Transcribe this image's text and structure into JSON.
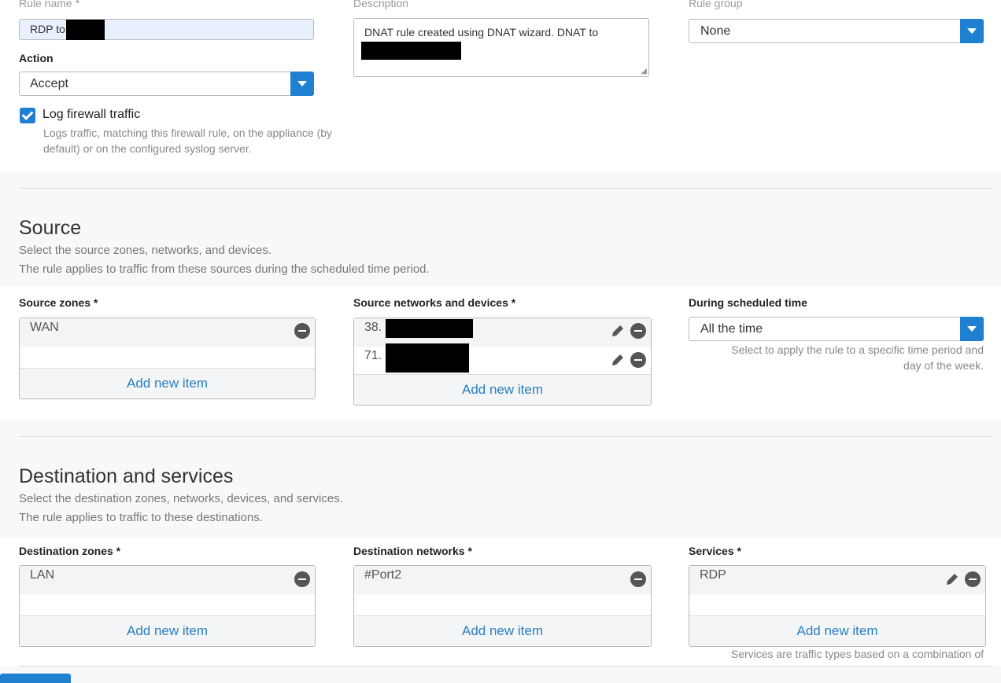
{
  "rule": {
    "name_label": "Rule name *",
    "name_value": "RDP to",
    "description_label": "Description",
    "description_value": "DNAT rule created using DNAT wizard. DNAT to",
    "group_label": "Rule group",
    "group_value": "None",
    "action_label": "Action",
    "action_value": "Accept",
    "log_label": "Log firewall traffic",
    "log_checked": true,
    "log_help_line1": "Logs traffic, matching this firewall rule, on the appliance (by",
    "log_help_line2": "default) or on the configured syslog server."
  },
  "source": {
    "title": "Source",
    "subtitle_line1": "Select the source zones, networks, and devices.",
    "subtitle_line2": "The rule applies to traffic from these sources during the scheduled time period.",
    "zones_label": "Source zones *",
    "zones": [
      "WAN"
    ],
    "networks_label": "Source networks and devices *",
    "networks": [
      "38.",
      "71."
    ],
    "schedule_label": "During scheduled time",
    "schedule_value": "All the time",
    "schedule_help_line1": "Select to apply the rule to a specific time period and",
    "schedule_help_line2": "day of the week.",
    "add_item": "Add new item"
  },
  "destination": {
    "title": "Destination and services",
    "subtitle_line1": "Select the destination zones, networks, devices, and services.",
    "subtitle_line2": "The rule applies to traffic to these destinations.",
    "zones_label": "Destination zones *",
    "zones": [
      "LAN"
    ],
    "networks_label": "Destination networks *",
    "networks": [
      "#Port2"
    ],
    "services_label": "Services *",
    "services": [
      "RDP"
    ],
    "services_help": "Services are traffic types based on a combination of",
    "add_item": "Add new item"
  },
  "colors": {
    "accent": "#1f7fd0",
    "link": "#2a7fc2"
  }
}
